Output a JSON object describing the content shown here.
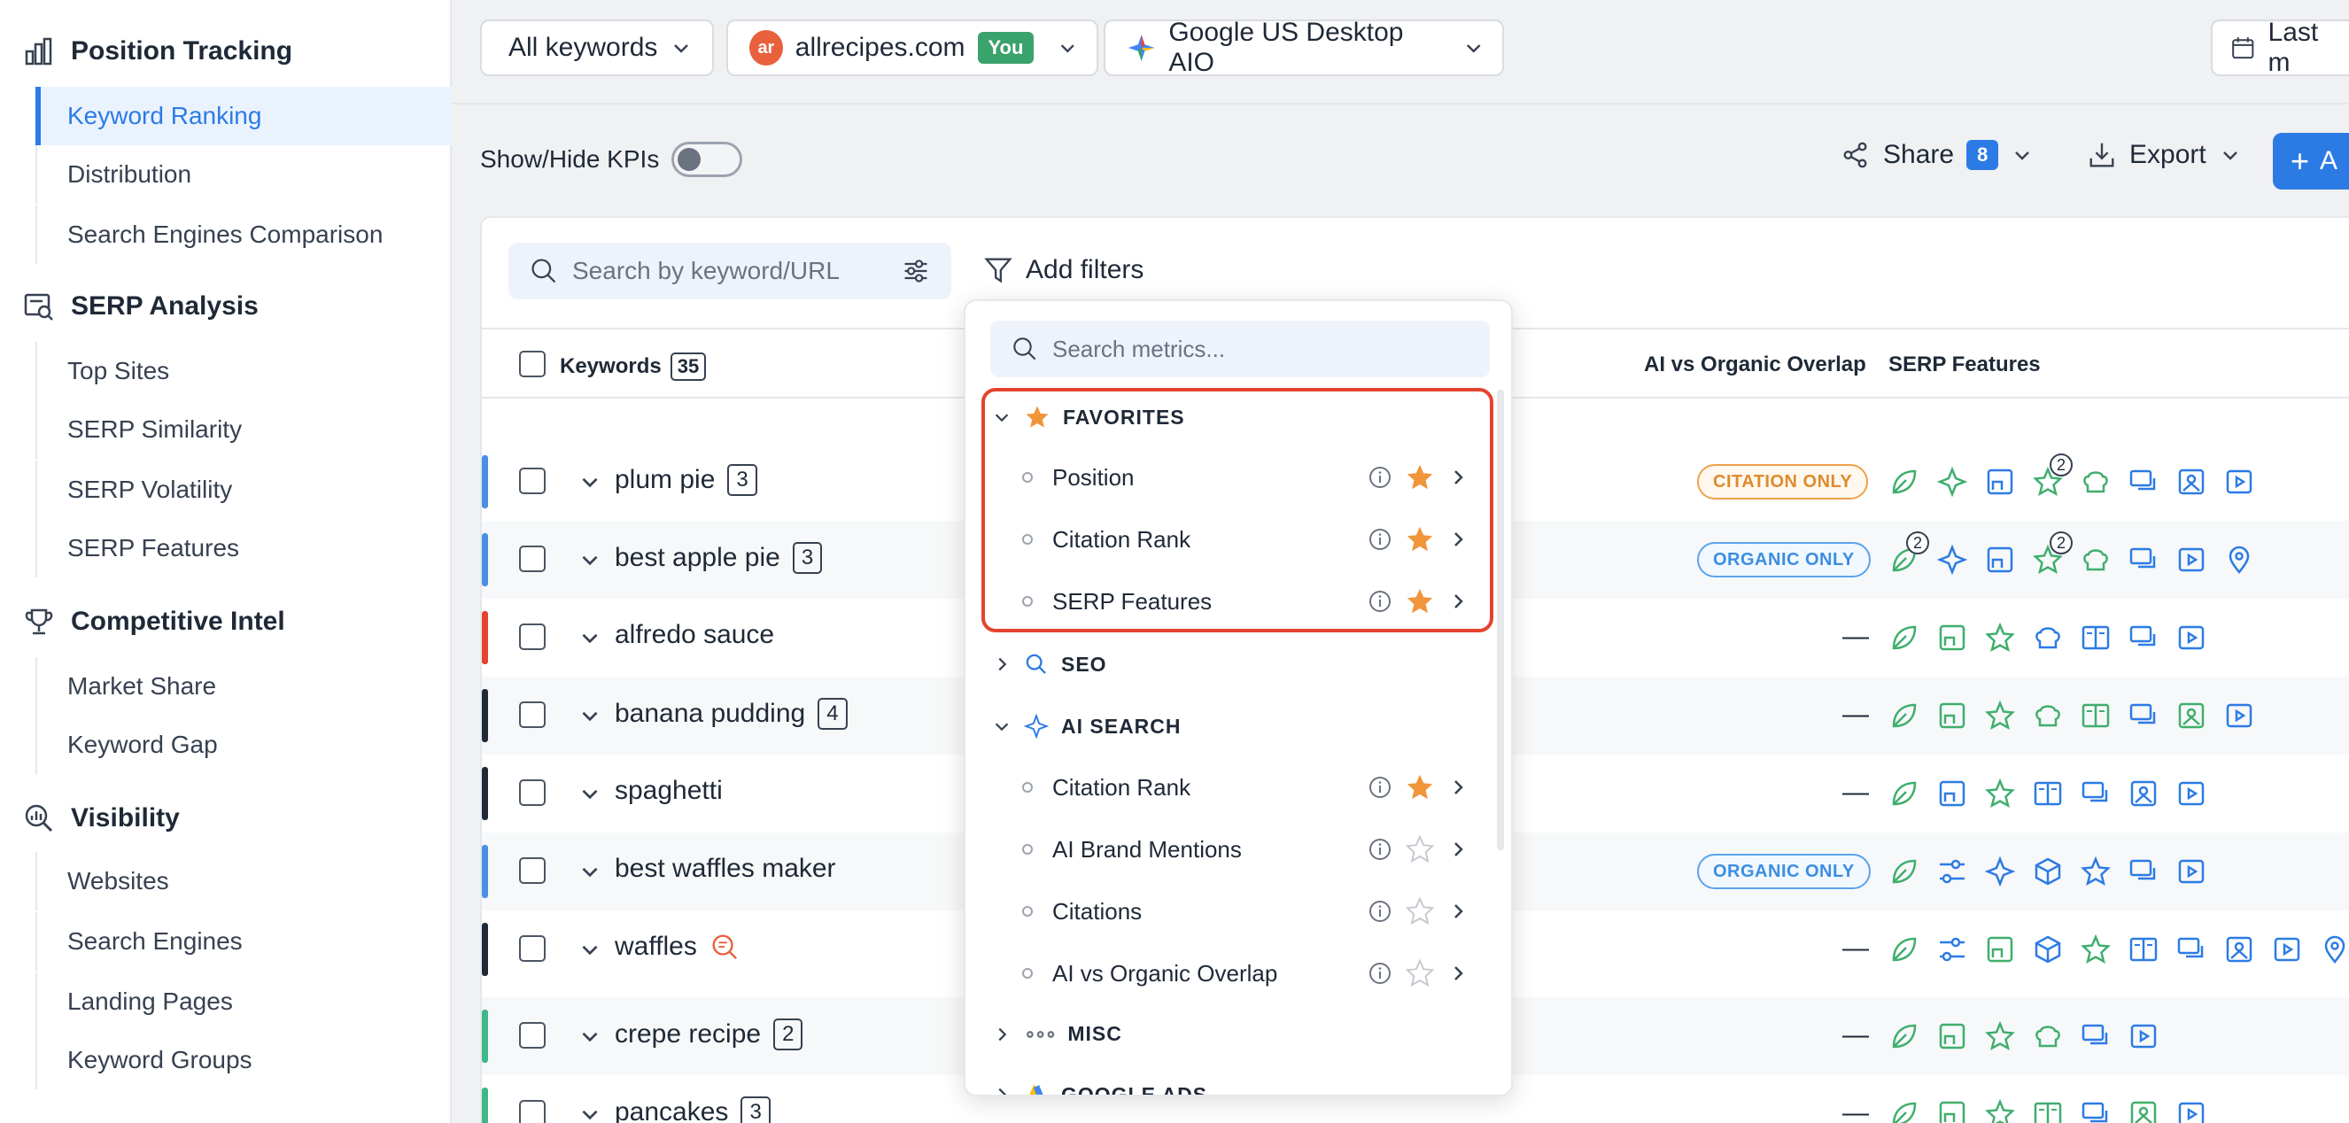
{
  "sidebar": {
    "sections": [
      {
        "title": "Position Tracking",
        "icon": "bar-chart-icon",
        "items": [
          "Keyword Ranking",
          "Distribution",
          "Search Engines Comparison"
        ]
      },
      {
        "title": "SERP Analysis",
        "icon": "serp-search-icon",
        "items": [
          "Top Sites",
          "SERP Similarity",
          "SERP Volatility",
          "SERP Features"
        ]
      },
      {
        "title": "Competitive Intel",
        "icon": "trophy-icon",
        "items": [
          "Market Share",
          "Keyword Gap"
        ]
      },
      {
        "title": "Visibility",
        "icon": "magnify-chart-icon",
        "items": [
          "Websites",
          "Search Engines",
          "Landing Pages",
          "Keyword Groups"
        ]
      }
    ],
    "active_item": "Keyword Ranking"
  },
  "topbar": {
    "keywords_select": "All keywords",
    "site_logo": "ar",
    "site_select": "allrecipes.com",
    "you_badge": "You",
    "engine_select": "Google US Desktop AIO",
    "date_select": "Last m"
  },
  "toolbar": {
    "kpi_toggle_label": "Show/Hide KPIs",
    "share_label": "Share",
    "share_count": "8",
    "export_label": "Export",
    "add_label": "A"
  },
  "table": {
    "search_placeholder": "Search by keyword/URL",
    "add_filters_label": "Add filters",
    "headers": {
      "keywords": "Keywords",
      "keywords_count": "35",
      "overlap": "AI vs Organic Overlap",
      "serp": "SERP Features"
    },
    "rows": [
      {
        "keyword": "plum pie",
        "count": "3",
        "color": "#4a90e2",
        "overlap": "CITATION ONLY",
        "overlap_type": "citation"
      },
      {
        "keyword": "best apple pie",
        "count": "3",
        "color": "#4a90e2",
        "overlap": "ORGANIC ONLY",
        "overlap_type": "organic"
      },
      {
        "keyword": "alfredo sauce",
        "count": "",
        "color": "#e5432d",
        "overlap": "—",
        "overlap_type": "dash"
      },
      {
        "keyword": "banana pudding",
        "count": "4",
        "color": "#1f2937",
        "overlap": "—",
        "overlap_type": "dash"
      },
      {
        "keyword": "spaghetti",
        "count": "",
        "color": "#1f2937",
        "overlap": "—",
        "overlap_type": "dash"
      },
      {
        "keyword": "best waffles maker",
        "count": "",
        "color": "#4a90e2",
        "overlap": "ORGANIC ONLY",
        "overlap_type": "organic"
      },
      {
        "keyword": "waffles",
        "count": "",
        "color": "#1f2937",
        "overlap": "—",
        "overlap_type": "dash"
      },
      {
        "keyword": "crepe recipe",
        "count": "2",
        "color": "#3db886",
        "overlap": "—",
        "overlap_type": "dash"
      },
      {
        "keyword": "pancakes",
        "count": "3",
        "color": "#3db886",
        "overlap": "—",
        "overlap_type": "dash"
      }
    ],
    "superscripts": {
      "plum_pie_star": "2",
      "apple_leaf": "2",
      "apple_star": "2"
    }
  },
  "dropdown": {
    "search_placeholder": "Search metrics...",
    "groups": {
      "favorites": "FAVORITES",
      "seo": "SEO",
      "ai_search": "AI SEARCH",
      "misc": "MISC",
      "google_ads": "GOOGLE ADS"
    },
    "favorites_items": [
      "Position",
      "Citation Rank",
      "SERP Features"
    ],
    "ai_items": [
      "Citation Rank",
      "AI Brand Mentions",
      "Citations",
      "AI vs Organic Overlap"
    ]
  },
  "colors": {
    "accent": "#2c7be5",
    "highlight": "#e5432d",
    "star": "#f0953a",
    "green_icon": "#3fae6d",
    "blue_icon": "#2c7be5"
  }
}
